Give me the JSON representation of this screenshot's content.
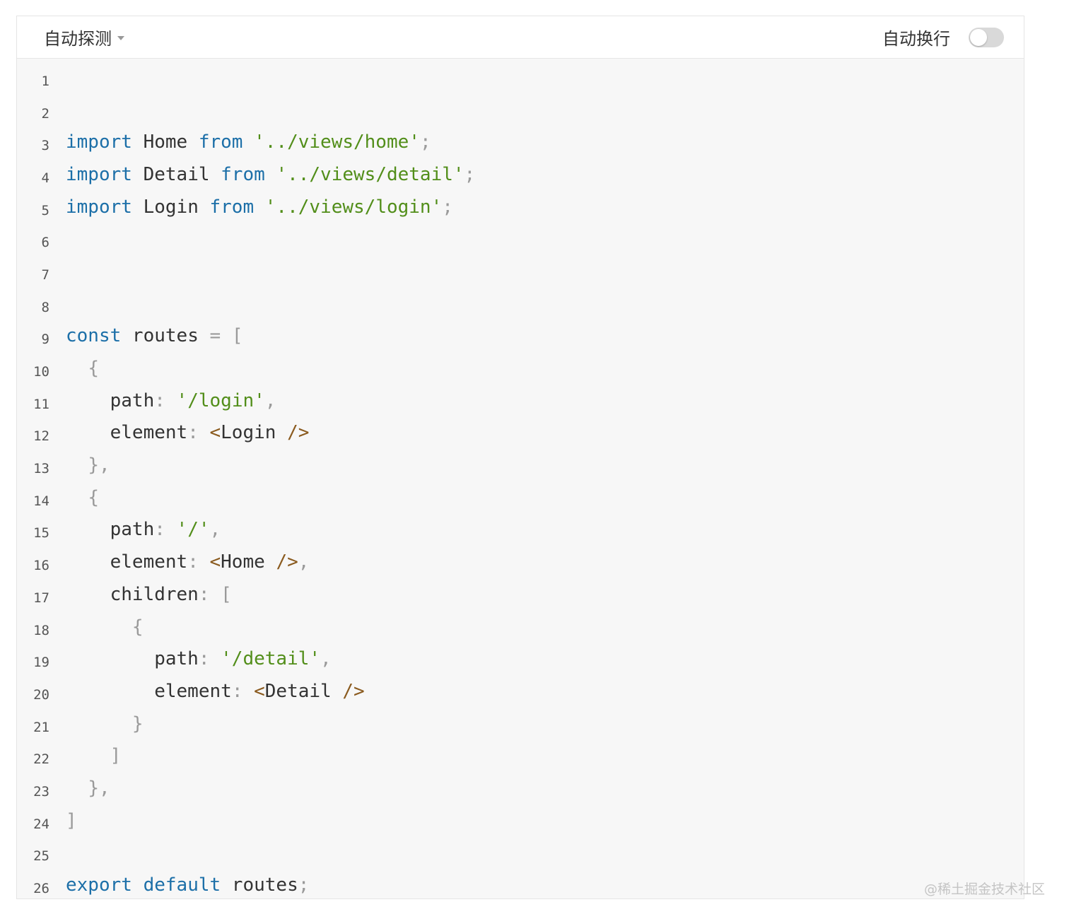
{
  "toolbar": {
    "language_label": "自动探测",
    "wrap_label": "自动换行",
    "wrap_enabled": false
  },
  "colors": {
    "keyword": "#1c6fa8",
    "string": "#528e1a",
    "punctuation": "#9a9a9a",
    "tag": "#8a5a1e",
    "identifier": "#333333",
    "background": "#f7f7f7"
  },
  "code_lines": [
    [],
    [],
    [
      [
        "kw",
        "import"
      ],
      [
        "id",
        " Home "
      ],
      [
        "kw",
        "from"
      ],
      [
        "id",
        " "
      ],
      [
        "str",
        "'../views/home'"
      ],
      [
        "punc",
        ";"
      ]
    ],
    [
      [
        "kw",
        "import"
      ],
      [
        "id",
        " Detail "
      ],
      [
        "kw",
        "from"
      ],
      [
        "id",
        " "
      ],
      [
        "str",
        "'../views/detail'"
      ],
      [
        "punc",
        ";"
      ]
    ],
    [
      [
        "kw",
        "import"
      ],
      [
        "id",
        " Login "
      ],
      [
        "kw",
        "from"
      ],
      [
        "id",
        " "
      ],
      [
        "str",
        "'../views/login'"
      ],
      [
        "punc",
        ";"
      ]
    ],
    [],
    [],
    [],
    [
      [
        "kw",
        "const"
      ],
      [
        "id",
        " routes "
      ],
      [
        "punc",
        "= ["
      ]
    ],
    [
      [
        "id",
        "  "
      ],
      [
        "punc",
        "{"
      ]
    ],
    [
      [
        "id",
        "    path"
      ],
      [
        "punc",
        ": "
      ],
      [
        "str",
        "'/login'"
      ],
      [
        "punc",
        ","
      ]
    ],
    [
      [
        "id",
        "    element"
      ],
      [
        "punc",
        ": "
      ],
      [
        "tag",
        "<"
      ],
      [
        "id",
        "Login "
      ],
      [
        "tag",
        "/>"
      ]
    ],
    [
      [
        "id",
        "  "
      ],
      [
        "punc",
        "},"
      ]
    ],
    [
      [
        "id",
        "  "
      ],
      [
        "punc",
        "{"
      ]
    ],
    [
      [
        "id",
        "    path"
      ],
      [
        "punc",
        ": "
      ],
      [
        "str",
        "'/'"
      ],
      [
        "punc",
        ","
      ]
    ],
    [
      [
        "id",
        "    element"
      ],
      [
        "punc",
        ": "
      ],
      [
        "tag",
        "<"
      ],
      [
        "id",
        "Home "
      ],
      [
        "tag",
        "/>"
      ],
      [
        "punc",
        ","
      ]
    ],
    [
      [
        "id",
        "    children"
      ],
      [
        "punc",
        ": ["
      ]
    ],
    [
      [
        "id",
        "      "
      ],
      [
        "punc",
        "{"
      ]
    ],
    [
      [
        "id",
        "        path"
      ],
      [
        "punc",
        ": "
      ],
      [
        "str",
        "'/detail'"
      ],
      [
        "punc",
        ","
      ]
    ],
    [
      [
        "id",
        "        element"
      ],
      [
        "punc",
        ": "
      ],
      [
        "tag",
        "<"
      ],
      [
        "id",
        "Detail "
      ],
      [
        "tag",
        "/>"
      ]
    ],
    [
      [
        "id",
        "      "
      ],
      [
        "punc",
        "}"
      ]
    ],
    [
      [
        "id",
        "    "
      ],
      [
        "punc",
        "]"
      ]
    ],
    [
      [
        "id",
        "  "
      ],
      [
        "punc",
        "},"
      ]
    ],
    [
      [
        "punc",
        "]"
      ]
    ],
    [],
    [
      [
        "kw",
        "export"
      ],
      [
        "id",
        " "
      ],
      [
        "kw",
        "default"
      ],
      [
        "id",
        " routes"
      ],
      [
        "punc",
        ";"
      ]
    ]
  ],
  "line_numbers": [
    "1",
    "2",
    "3",
    "4",
    "5",
    "6",
    "7",
    "8",
    "9",
    "10",
    "11",
    "12",
    "13",
    "14",
    "15",
    "16",
    "17",
    "18",
    "19",
    "20",
    "21",
    "22",
    "23",
    "24",
    "25",
    "26"
  ],
  "watermark": "@稀土掘金技术社区"
}
